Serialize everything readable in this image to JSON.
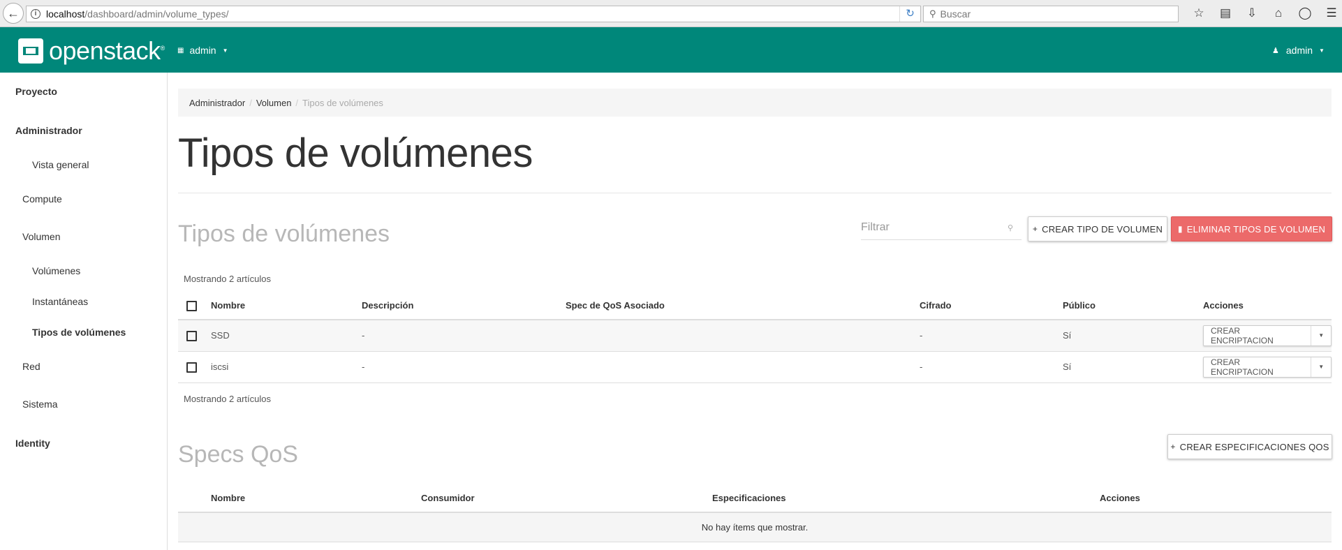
{
  "browser": {
    "url_host": "localhost",
    "url_path": "/dashboard/admin/volume_types/",
    "search_placeholder": "Buscar"
  },
  "header": {
    "logo_text": "openstack",
    "project": "admin",
    "user": "admin"
  },
  "sidebar": {
    "items": [
      {
        "label": "Proyecto"
      },
      {
        "label": "Administrador"
      },
      {
        "label": "Vista general"
      },
      {
        "label": "Compute"
      },
      {
        "label": "Volumen"
      },
      {
        "label": "Volúmenes"
      },
      {
        "label": "Instantáneas"
      },
      {
        "label": "Tipos de volúmenes"
      },
      {
        "label": "Red"
      },
      {
        "label": "Sistema"
      },
      {
        "label": "Identity"
      }
    ]
  },
  "breadcrumb": [
    "Administrador",
    "Volumen",
    "Tipos de volúmenes"
  ],
  "page_title": "Tipos de volúmenes",
  "volume_types": {
    "title": "Tipos de volúmenes",
    "filter_placeholder": "Filtrar",
    "create_button": "CREAR TIPO DE VOLUMEN",
    "delete_button": "ELIMINAR TIPOS DE VOLUMEN",
    "count_top": "Mostrando 2 artículos",
    "count_bottom": "Mostrando 2 artículos",
    "columns": [
      "Nombre",
      "Descripción",
      "Spec de QoS Asociado",
      "Cifrado",
      "Público",
      "Acciones"
    ],
    "rows": [
      {
        "name": "SSD",
        "description": "-",
        "qos": "",
        "encrypted": "-",
        "public": "Sí",
        "action": "CREAR ENCRIPTACION"
      },
      {
        "name": "iscsi",
        "description": "-",
        "qos": "",
        "encrypted": "-",
        "public": "Sí",
        "action": "CREAR ENCRIPTACION"
      }
    ]
  },
  "qos_specs": {
    "title": "Specs QoS",
    "create_button": "CREAR ESPECIFICACIONES QOS",
    "columns": [
      "Nombre",
      "Consumidor",
      "Especificaciones",
      "Acciones"
    ],
    "empty_text": "No hay ítems que mostrar."
  }
}
